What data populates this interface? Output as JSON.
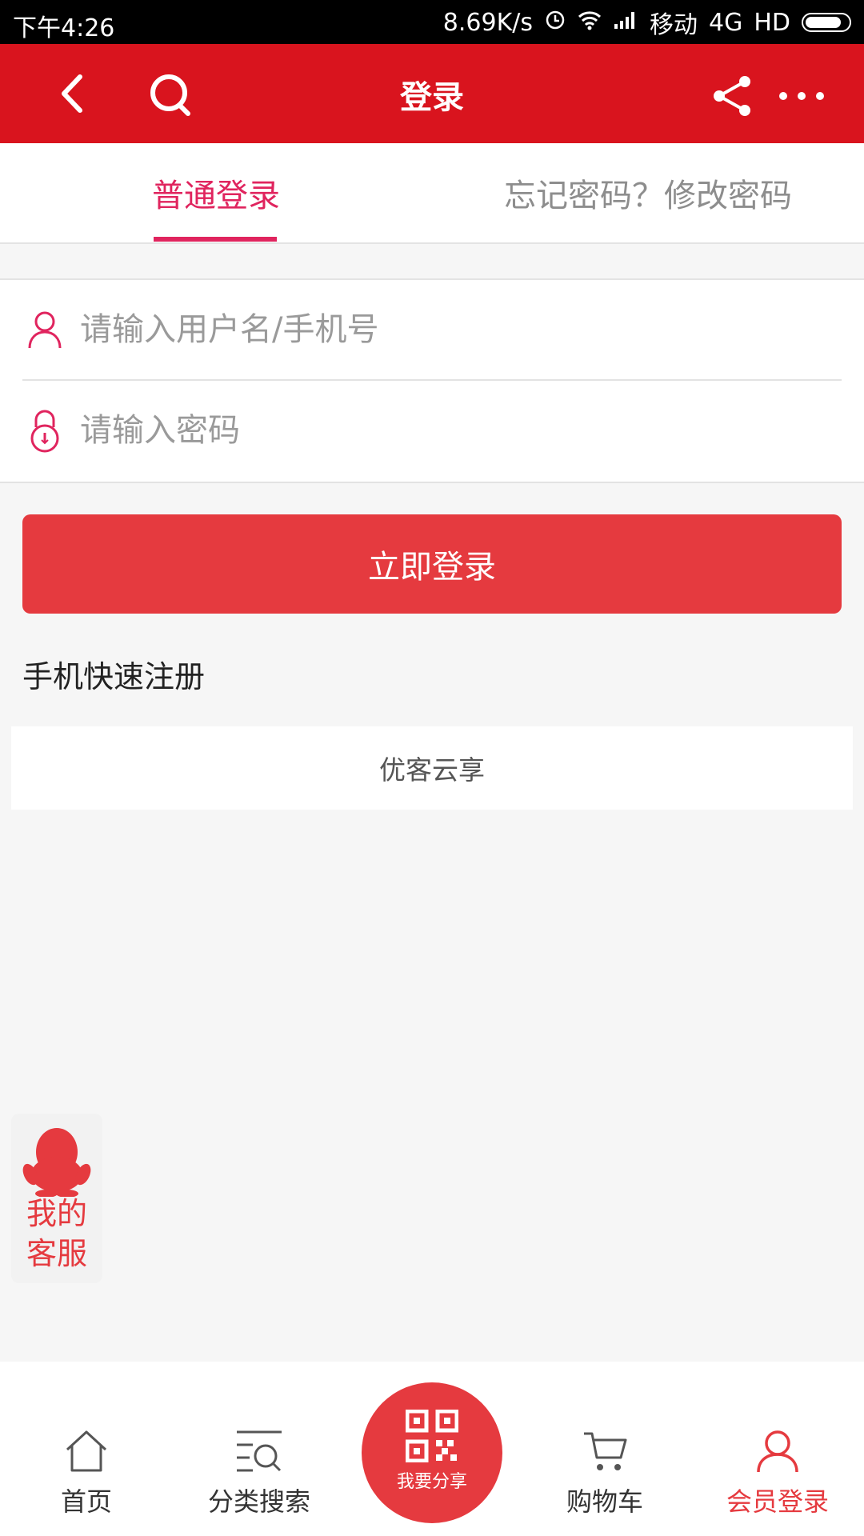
{
  "status_bar": {
    "time": "下午4:26",
    "speed": "8.69K/s",
    "carrier": "移动",
    "network": "4G",
    "hd": "HD"
  },
  "app_bar": {
    "title": "登录",
    "icons": [
      "back-icon",
      "search-icon",
      "share-icon",
      "more-icon"
    ]
  },
  "tabs": {
    "normal_login": "普通登录",
    "forgot_password": "忘记密码？修改密码"
  },
  "form": {
    "username_placeholder": "请输入用户名/手机号",
    "password_placeholder": "请输入密码",
    "login_button": "立即登录",
    "register_link": "手机快速注册"
  },
  "brand": "优客云享",
  "customer_service": {
    "line1": "我的",
    "line2": "客服"
  },
  "bottom_nav": {
    "home": "首页",
    "category": "分类搜索",
    "share": "我要分享",
    "cart": "购物车",
    "member": "会员登录"
  },
  "colors": {
    "app_bar": "#d9141e",
    "accent": "#e0245e",
    "button": "#e53a3f"
  }
}
